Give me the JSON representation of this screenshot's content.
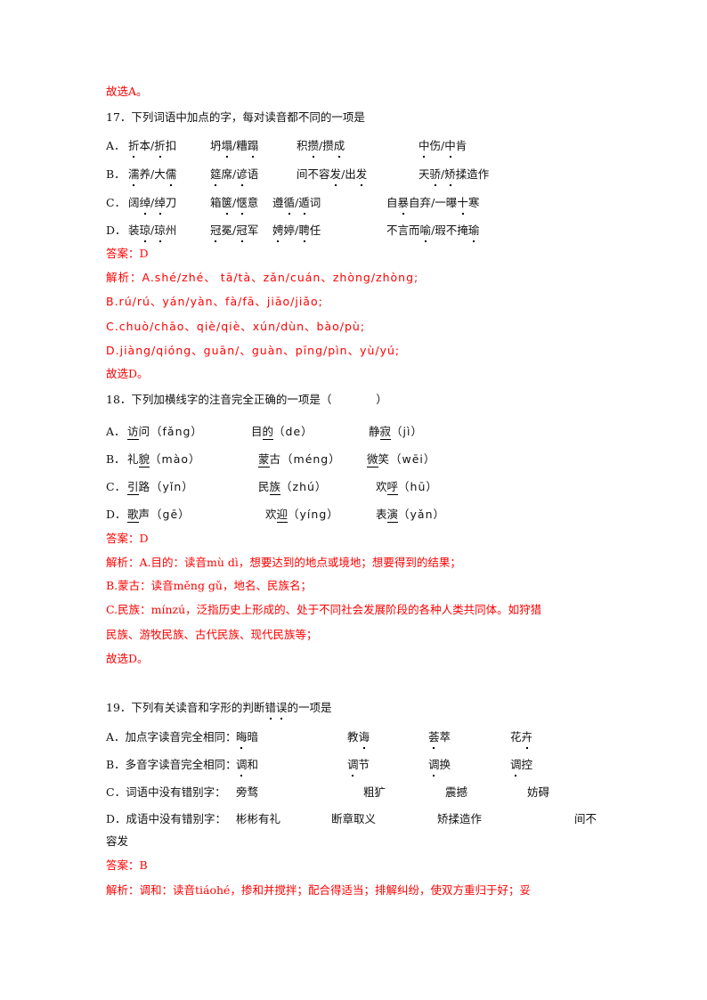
{
  "prev_conclusion": "故选A。",
  "q17": {
    "title": "17．下列词语中加点的字，每对读音都不同的一项是",
    "options": [
      {
        "label": "A．",
        "items": [
          "折本/折扣",
          "坍塌/糟蹋",
          "积攒/攒成",
          "中伤/中肯"
        ]
      },
      {
        "label": "B．",
        "items": [
          "濡养/大儒",
          "筵席/谚语",
          "间不容发/出发",
          "天骄/矫揉造作"
        ]
      },
      {
        "label": "C．",
        "items": [
          "阔绰/绰刀",
          "箱箧/惬意",
          "遵循/遁词",
          "自暴自弃/一曝十寒"
        ]
      },
      {
        "label": "D．",
        "items": [
          "装琼/琼州",
          "冠冕/冠军",
          "娉婷/聘任",
          "不言而喻/瑕不掩瑜"
        ]
      }
    ],
    "answer": "答案：D",
    "analysis": [
      "解析：A.shé/zhé、 tā/tà、zǎn/cuán、zhòng/zhòng;",
      "B.rú/rú、yán/yàn、fà/fā、jiāo/jiǎo;",
      "C.chuò/chāo、qiè/qiè、xún/dùn、bào/pù;",
      "D.jiàng/qióng、guān/、guàn、pīng/pìn、yù/yú;",
      "故选D。"
    ]
  },
  "q18": {
    "title": "18．下列加横线字的注音完全正确的一项是（　　　　）",
    "options": [
      {
        "label": "A．",
        "items": [
          {
            "pre": "",
            "ul": "访",
            "post": "问（fǎng）"
          },
          {
            "pre": "目",
            "ul": "的",
            "post": "（de）"
          },
          {
            "pre": "静",
            "ul": "寂",
            "post": "（jì）"
          }
        ]
      },
      {
        "label": "B．",
        "items": [
          {
            "pre": "礼",
            "ul": "貌",
            "post": "（mào）"
          },
          {
            "pre": "",
            "ul": "蒙",
            "post": "古（méng）"
          },
          {
            "pre": "",
            "ul": "微",
            "post": "笑（wēi）"
          }
        ]
      },
      {
        "label": "C．",
        "items": [
          {
            "pre": "",
            "ul": "引",
            "post": "路（yǐn）"
          },
          {
            "pre": "民",
            "ul": "族",
            "post": "（zhú）"
          },
          {
            "pre": "欢",
            "ul": "呼",
            "post": "（hū）"
          }
        ]
      },
      {
        "label": "D．",
        "items": [
          {
            "pre": "",
            "ul": "歌",
            "post": "声（gē）"
          },
          {
            "pre": "欢",
            "ul": "迎",
            "post": "（yíng）"
          },
          {
            "pre": "表",
            "ul": "演",
            "post": "（yǎn）"
          }
        ]
      }
    ],
    "answer": "答案：D",
    "analysis": [
      "解析：A.目的：读音mù dì，想要达到的地点或境地；想要得到的结果；",
      "B.蒙古：读音měng gǔ，地名、民族名；",
      "C.民族：mínzú，泛指历史上形成的、处于不同社会发展阶段的各种人类共同体。如狩猎",
      "民族、游牧民族、古代民族、现代民族等；",
      "故选D。"
    ]
  },
  "q19": {
    "title_pre": "19．下列有关读音和字形的判断",
    "title_dot": "错误",
    "title_post": "的一项是",
    "options": [
      {
        "label": "A．",
        "lead": "加点字读音完全相同：",
        "items": [
          "晦暗",
          "教诲",
          "荟萃",
          "花卉"
        ]
      },
      {
        "label": "B．",
        "lead": "多音字读音完全相同：",
        "items": [
          "调和",
          "调节",
          "调换",
          "调控"
        ]
      },
      {
        "label": "C．",
        "lead": "词语中没有错别字：",
        "items": [
          "旁骛",
          "粗犷",
          "震撼",
          "妨碍"
        ]
      },
      {
        "label": "D．",
        "lead": "成语中没有错别字：",
        "items": [
          "彬彬有礼",
          "断章取义",
          "矫揉造作",
          "间不"
        ]
      }
    ],
    "d_wrap": "容发",
    "answer": "答案：B",
    "analysis": "解析：调和：读音tiáohé，掺和并搅拌；配合得适当；排解纠纷，使双方重归于好；妥"
  }
}
